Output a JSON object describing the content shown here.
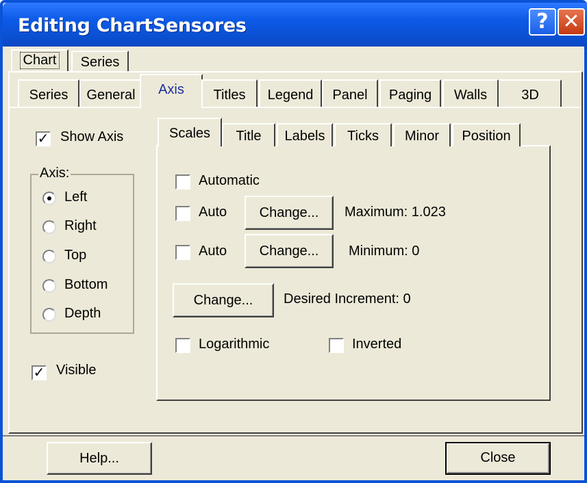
{
  "window": {
    "title": "Editing ChartSensores",
    "help_glyph": "?",
    "close_glyph": "✕"
  },
  "top_tabs": [
    "Chart",
    "Series"
  ],
  "chart_tabs": [
    "Series",
    "General",
    "Axis",
    "Titles",
    "Legend",
    "Panel",
    "Paging",
    "Walls",
    "3D"
  ],
  "left_panel": {
    "show_axis": "Show Axis",
    "axis_group": "Axis:",
    "radios": [
      "Left",
      "Right",
      "Top",
      "Bottom",
      "Depth"
    ],
    "selected_radio": "Left",
    "visible": "Visible"
  },
  "axis_tabs": [
    "Scales",
    "Title",
    "Labels",
    "Ticks",
    "Minor",
    "Position"
  ],
  "scales": {
    "automatic": "Automatic",
    "auto_max": "Auto",
    "auto_min": "Auto",
    "change_max": "Change...",
    "change_min": "Change...",
    "maximum": "Maximum: 1.023",
    "minimum": "Minimum: 0",
    "change_increment": "Change...",
    "desired_increment": "Desired Increment: 0",
    "logarithmic": "Logarithmic",
    "inverted": "Inverted"
  },
  "footer": {
    "help": "Help...",
    "close": "Close"
  },
  "checkmark": "✓"
}
